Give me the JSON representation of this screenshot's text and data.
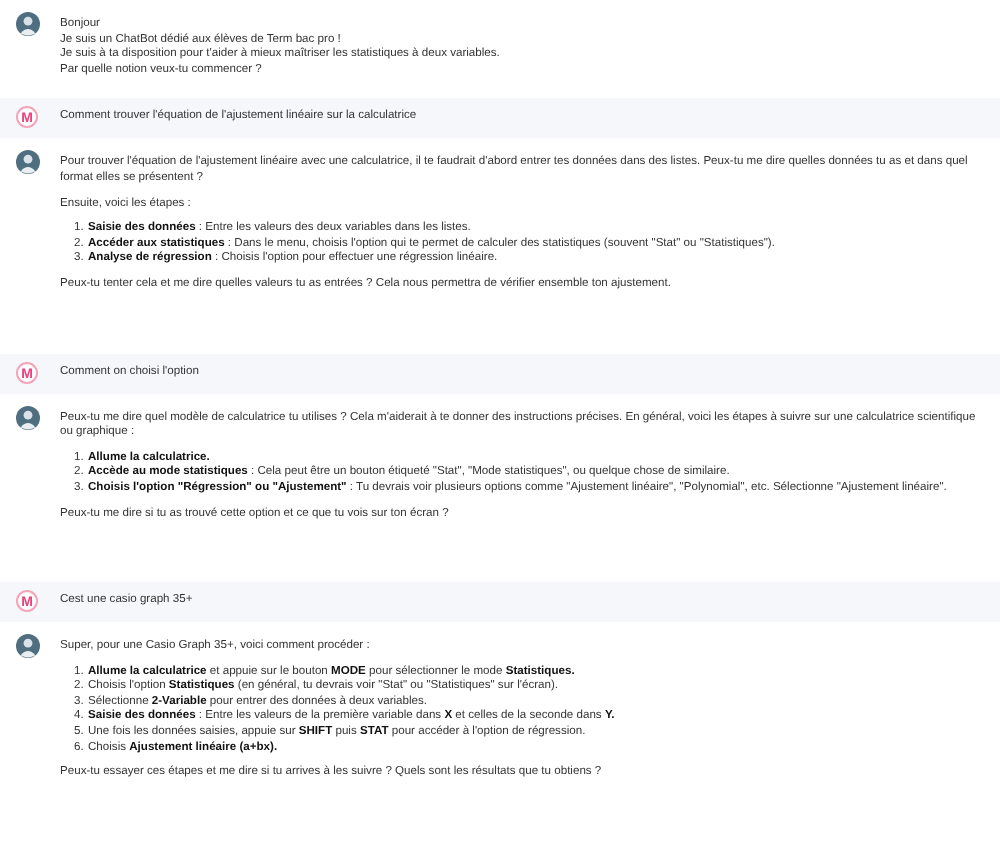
{
  "messages": [
    {
      "kind": "bot",
      "blocks": [
        {
          "kind": "lines",
          "items": [
            "Bonjour",
            "Je suis un ChatBot dédié aux élèves de Term bac pro !",
            "Je suis à ta disposition pour t'aider à mieux maîtriser les statistiques à deux variables.",
            "Par quelle notion veux-tu commencer ?"
          ]
        }
      ]
    },
    {
      "kind": "user",
      "logo": "M",
      "blocks": [
        {
          "kind": "p",
          "text": "Comment trouver l'équation de l'ajustement linéaire sur la calculatrice"
        }
      ]
    },
    {
      "kind": "bot",
      "blocks": [
        {
          "kind": "p",
          "text": "Pour trouver l'équation de l'ajustement linéaire avec une calculatrice, il te faudrait d'abord entrer tes données dans des listes. Peux-tu me dire quelles données tu as et dans quel format elles se présentent ?"
        },
        {
          "kind": "p",
          "text": "Ensuite, voici les étapes :"
        },
        {
          "kind": "ol",
          "items": [
            {
              "num": "1.",
              "text": "**Saisie des données** : Entre les valeurs des deux variables dans les listes."
            },
            {
              "num": "2.",
              "text": "**Accéder aux statistiques** : Dans le menu, choisis l'option qui te permet de calculer des statistiques (souvent \"Stat\" ou \"Statistiques\")."
            },
            {
              "num": "3.",
              "text": "**Analyse de régression** : Choisis l'option pour effectuer une régression linéaire."
            }
          ]
        },
        {
          "kind": "p",
          "text": "Peux-tu tenter cela et me dire quelles valeurs tu as entrées ? Cela nous permettra de vérifier ensemble ton ajustement."
        }
      ]
    },
    {
      "kind": "user",
      "logo": "M",
      "blocks": [
        {
          "kind": "p",
          "text": "Comment on choisi l'option"
        }
      ]
    },
    {
      "kind": "bot",
      "blocks": [
        {
          "kind": "p",
          "text": "Peux-tu me dire quel modèle de calculatrice tu utilises ? Cela m'aiderait à te donner des instructions précises. En général, voici les étapes à suivre sur une calculatrice scientifique ou graphique :"
        },
        {
          "kind": "ol",
          "items": [
            {
              "num": "1.",
              "text": "**Allume la calculatrice.**"
            },
            {
              "num": "2.",
              "text": "**Accède au mode statistiques** : Cela peut être un bouton étiqueté \"Stat\", \"Mode statistiques\", ou quelque chose de similaire."
            },
            {
              "num": "3.",
              "text": "**Choisis l'option \"Régression\" ou \"Ajustement\"** : Tu devrais voir plusieurs options comme \"Ajustement linéaire\", \"Polynomial\", etc. Sélectionne \"Ajustement linéaire\"."
            }
          ]
        },
        {
          "kind": "p",
          "text": "Peux-tu me dire si tu as trouvé cette option et ce que tu vois sur ton écran ?"
        }
      ]
    },
    {
      "kind": "user",
      "logo": "M",
      "blocks": [
        {
          "kind": "p",
          "text": "Cest une casio graph 35+"
        }
      ]
    },
    {
      "kind": "bot",
      "blocks": [
        {
          "kind": "p",
          "text": "Super, pour une Casio Graph 35+, voici comment procéder :"
        },
        {
          "kind": "ol",
          "items": [
            {
              "num": "1.",
              "text": "**Allume la calculatrice** et appuie sur le bouton **MODE** pour sélectionner le mode **Statistiques.**"
            },
            {
              "num": "2.",
              "text": "Choisis l'option **Statistiques** (en général, tu devrais voir \"Stat\" ou \"Statistiques\" sur l'écran)."
            },
            {
              "num": "3.",
              "text": "Sélectionne **2-Variable** pour entrer des données à deux variables."
            },
            {
              "num": "4.",
              "text": "**Saisie des données** : Entre les valeurs de la première variable dans **X** et celles de la seconde dans **Y.**"
            },
            {
              "num": "5.",
              "text": "Une fois les données saisies, appuie sur **SHIFT** puis **STAT** pour accéder à l'option de régression."
            },
            {
              "num": "6.",
              "text": "Choisis **Ajustement linéaire (a+bx).**"
            }
          ]
        },
        {
          "kind": "p",
          "text": "Peux-tu essayer ces étapes et me dire si tu arrives à les suivre ? Quels sont les résultats que tu obtiens ?"
        }
      ]
    }
  ]
}
